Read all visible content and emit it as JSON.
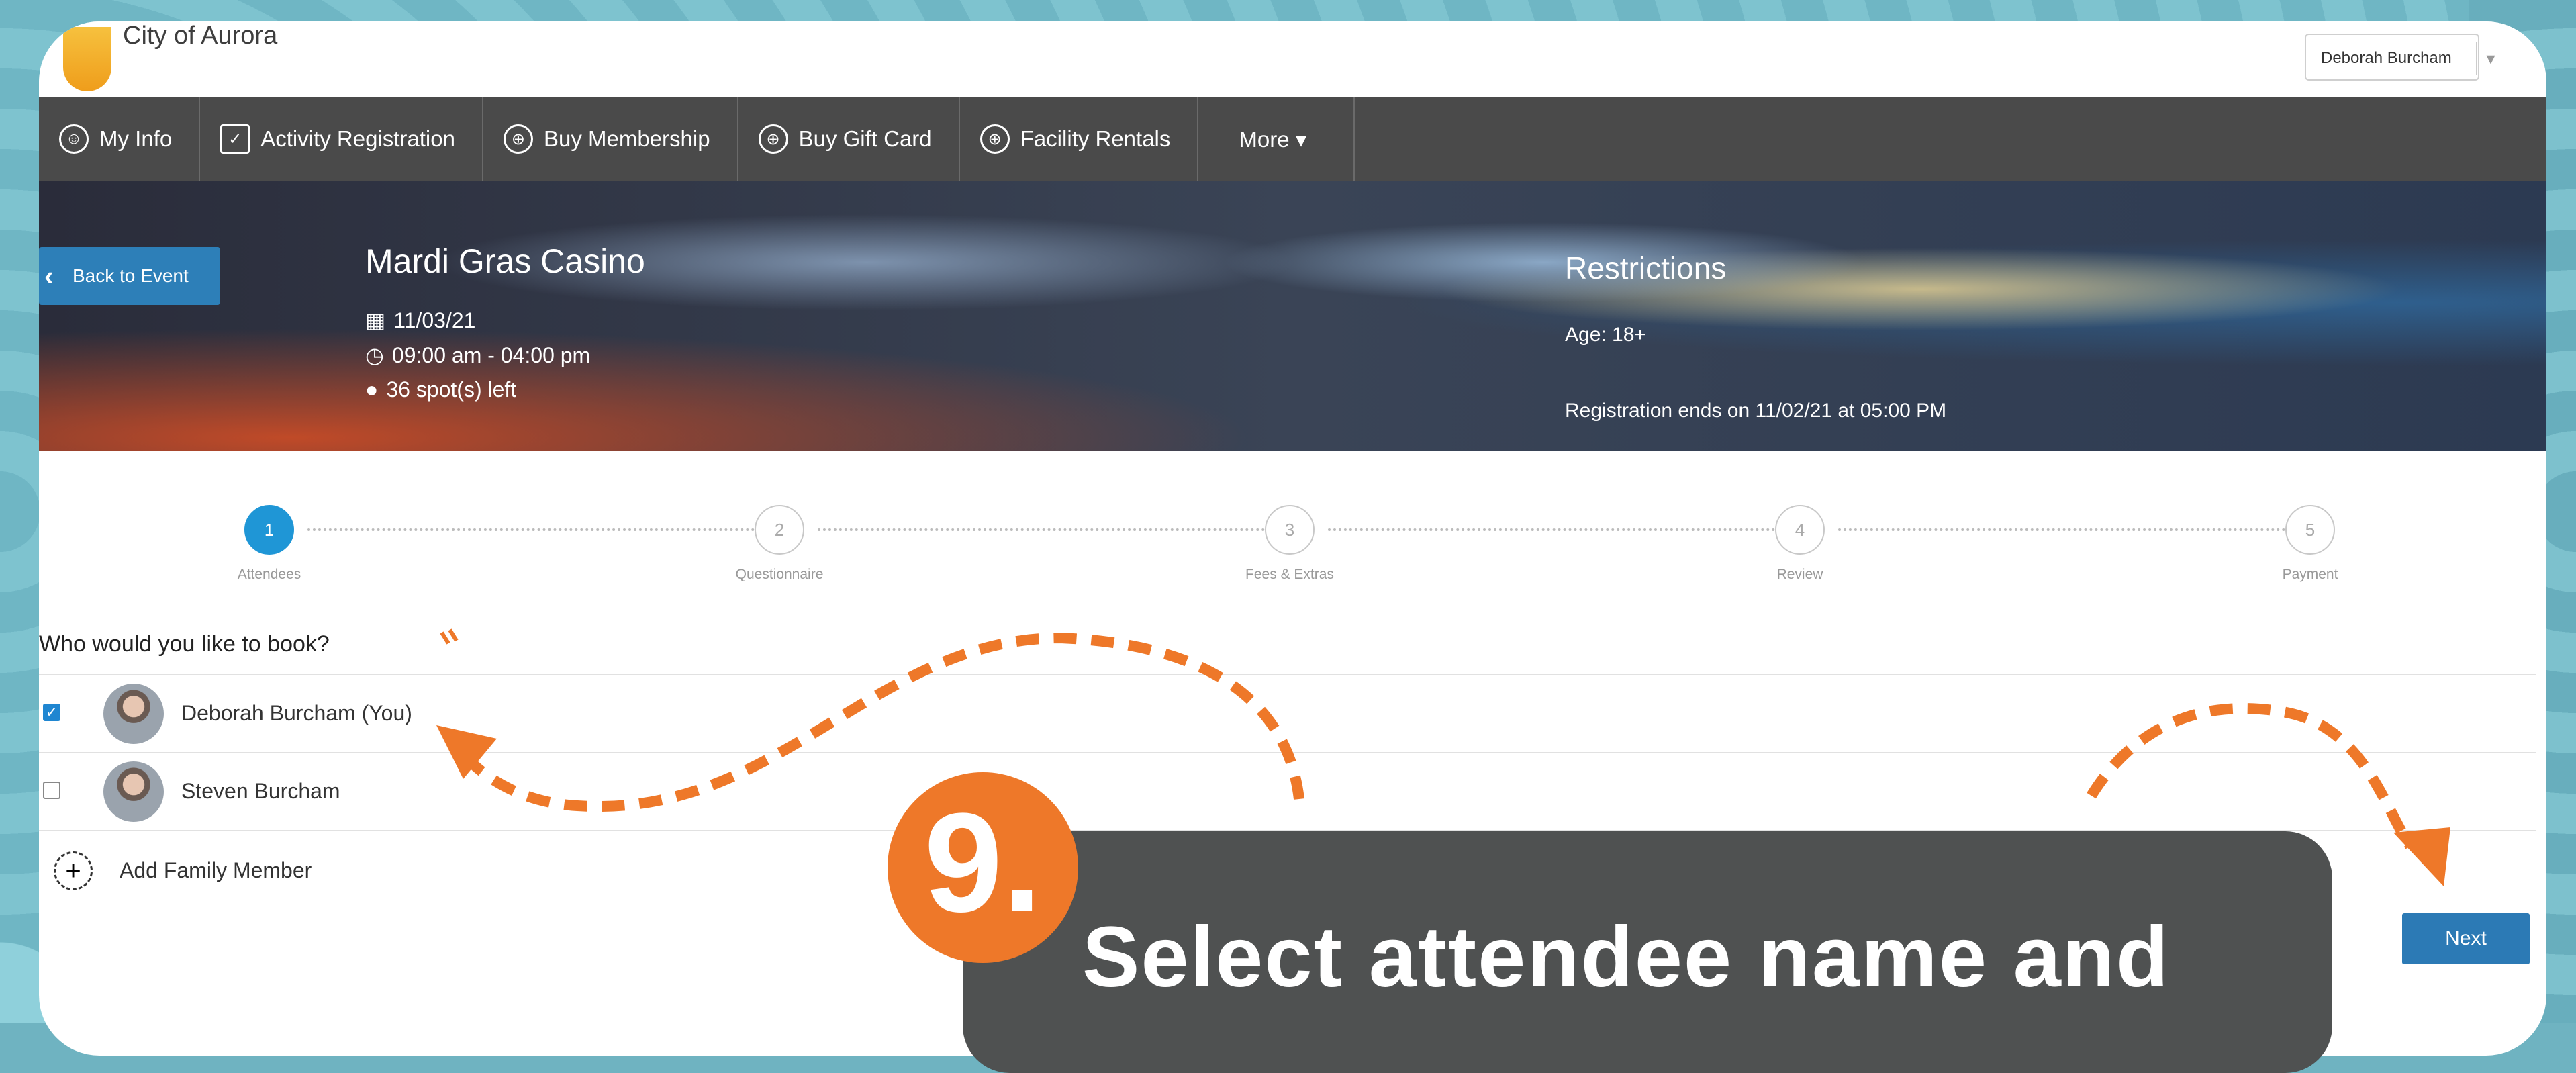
{
  "header": {
    "city": "City of Aurora",
    "user": "Deborah Burcham"
  },
  "nav": [
    {
      "label": "My Info",
      "icon": "user-circle-icon"
    },
    {
      "label": "Activity Registration",
      "icon": "calendar-check-icon"
    },
    {
      "label": "Buy Membership",
      "icon": "globe-icon"
    },
    {
      "label": "Buy Gift Card",
      "icon": "globe-icon"
    },
    {
      "label": "Facility Rentals",
      "icon": "globe-icon"
    },
    {
      "label": "More ▾",
      "icon": ""
    }
  ],
  "event": {
    "back_label": "Back to Event",
    "title": "Mardi Gras Casino",
    "date": "11/03/21",
    "time": "09:00 am - 04:00 pm",
    "spots": "36 spot(s) left",
    "restrictions_title": "Restrictions",
    "age": "Age: 18+",
    "reg_ends": "Registration ends on 11/02/21 at 05:00 PM"
  },
  "steps": [
    {
      "num": "1",
      "label": "Attendees",
      "active": true
    },
    {
      "num": "2",
      "label": "Questionnaire",
      "active": false
    },
    {
      "num": "3",
      "label": "Fees & Extras",
      "active": false
    },
    {
      "num": "4",
      "label": "Review",
      "active": false
    },
    {
      "num": "5",
      "label": "Payment",
      "active": false
    }
  ],
  "booking": {
    "question": "Who would you like to book?",
    "people": [
      {
        "name": "Deborah Burcham (You)",
        "checked": true
      },
      {
        "name": "Steven Burcham",
        "checked": false
      }
    ],
    "add_label": "Add Family Member",
    "next_label": "Next"
  },
  "callout": {
    "number": "9.",
    "text": "Select attendee name and"
  },
  "colors": {
    "accent_orange": "#ee7829",
    "primary_blue": "#2c7ab5",
    "nav_bg": "#4a4a4a"
  }
}
